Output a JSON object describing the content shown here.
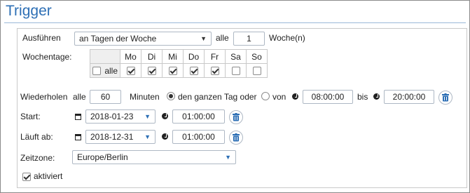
{
  "title": "Trigger",
  "execute": {
    "label": "Ausführen",
    "select_value": "an Tagen der Woche",
    "every_label": "alle",
    "every_value": "1",
    "unit_label": "Woche(n)"
  },
  "weekdays": {
    "label": "Wochentage:",
    "all_label": "alle",
    "all_checked": false,
    "days": [
      {
        "label": "Mo",
        "checked": true
      },
      {
        "label": "Di",
        "checked": true
      },
      {
        "label": "Mi",
        "checked": true
      },
      {
        "label": "Do",
        "checked": true
      },
      {
        "label": "Fr",
        "checked": true
      },
      {
        "label": "Sa",
        "checked": false
      },
      {
        "label": "So",
        "checked": false
      }
    ]
  },
  "repeat": {
    "label": "Wiederholen",
    "every_label": "alle",
    "every_value": "60",
    "unit_label": "Minuten",
    "all_day_label": "den ganzen Tag oder",
    "all_day_selected": true,
    "from_label": "von",
    "from_value": "08:00:00",
    "to_label": "bis",
    "to_value": "20:00:00"
  },
  "start": {
    "label": "Start:",
    "date": "2018-01-23",
    "time": "01:00:00"
  },
  "expires": {
    "label": "Läuft ab:",
    "date": "2018-12-31",
    "time": "01:00:00"
  },
  "timezone": {
    "label": "Zeitzone:",
    "value": "Europe/Berlin"
  },
  "activated": {
    "label": "aktiviert",
    "checked": true
  },
  "icons": {
    "clock": "clock-icon",
    "calendar": "calendar-icon",
    "trash": "trash-icon",
    "dropdown": "chevron-down-icon"
  },
  "colors": {
    "accent": "#2d6fb5",
    "border": "#aeb8c4"
  }
}
